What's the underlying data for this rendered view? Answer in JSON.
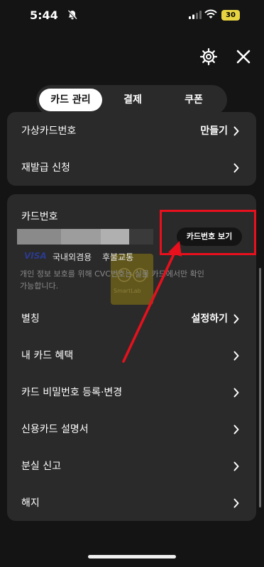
{
  "status_bar": {
    "time": "5:44",
    "battery": "30"
  },
  "tabs": [
    {
      "label": "카드 관리",
      "active": true
    },
    {
      "label": "결제",
      "active": false
    },
    {
      "label": "쿠폰",
      "active": false
    }
  ],
  "top_card": {
    "rows": [
      {
        "label": "가상카드번호",
        "value": "만들기"
      },
      {
        "label": "재발급 신청",
        "value": ""
      }
    ]
  },
  "card_info": {
    "card_number_label": "카드번호",
    "view_button": "카드번호 보기",
    "brand": "VISA",
    "types": [
      "국내외겸용",
      "후불교통"
    ],
    "notice": "개인 정보 보호를 위해 CVC번호는 실물 카드에서만 확인 가능합니다.",
    "watermark": "SmartLab"
  },
  "menu": [
    {
      "label": "별칭",
      "value": "설정하기"
    },
    {
      "label": "내 카드 혜택",
      "value": ""
    },
    {
      "label": "카드 비밀번호 등록·변경",
      "value": ""
    },
    {
      "label": "신용카드 설명서",
      "value": ""
    },
    {
      "label": "분실 신고",
      "value": ""
    },
    {
      "label": "해지",
      "value": ""
    }
  ],
  "colors": {
    "background": "#141414",
    "card": "#2a2a2a",
    "highlight": "#e8101d",
    "brand_visa": "#2b3a8f"
  },
  "icons": [
    "bell-slash-icon",
    "signal-icon",
    "wifi-icon",
    "battery-icon",
    "gear-icon",
    "close-icon",
    "chevron-right-icon"
  ]
}
